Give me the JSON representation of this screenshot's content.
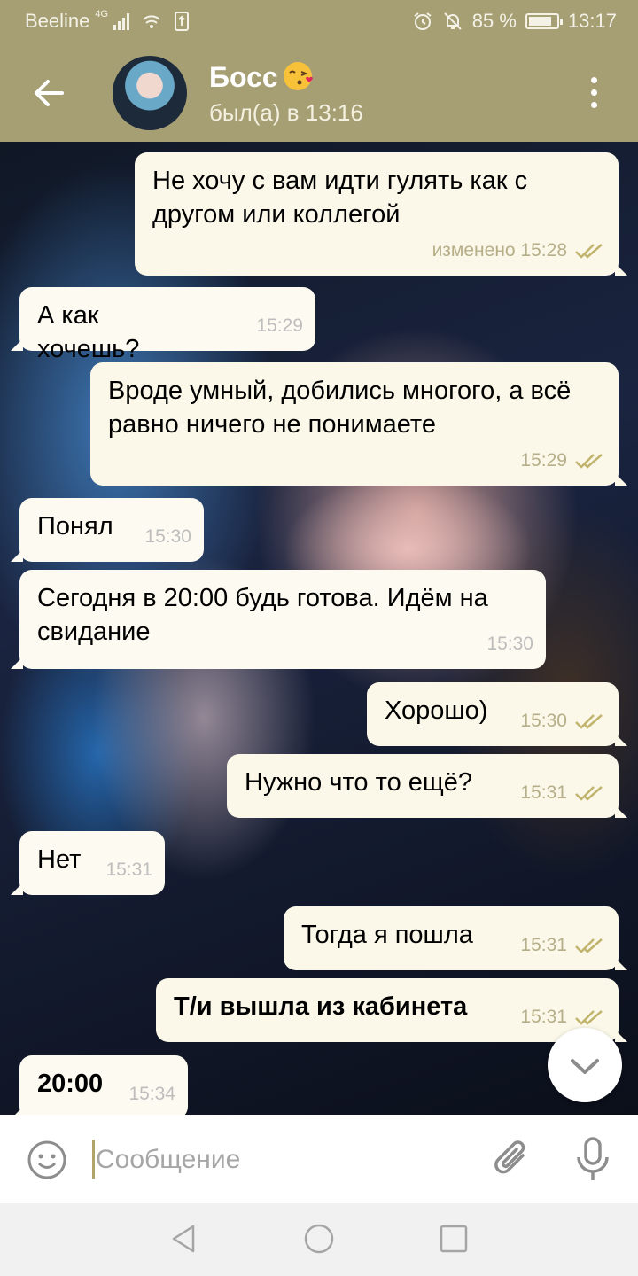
{
  "status_bar": {
    "carrier": "Beeline",
    "network": "4G",
    "battery": "85 %",
    "battery_level": 0.85,
    "time": "13:17"
  },
  "header": {
    "name": "Босс",
    "emoji_icon": "kissing-face-icon",
    "status": "был(а) в 13:16"
  },
  "messages": [
    {
      "dir": "out",
      "text": "Не хочу с вам идти гулять как с другом или коллегой",
      "time": "изменено 15:28",
      "read": true
    },
    {
      "dir": "in",
      "text": "А как хочешь?",
      "time": "15:29"
    },
    {
      "dir": "out",
      "text": "Вроде умный, добились многого, а всё равно ничего не понимаете",
      "time": "15:29",
      "read": true
    },
    {
      "dir": "in",
      "text": "Понял",
      "time": "15:30"
    },
    {
      "dir": "in",
      "text": "Сегодня в 20:00 будь готова. Идём на свидание",
      "time": "15:30"
    },
    {
      "dir": "out",
      "text": "Хорошо)",
      "time": "15:30",
      "read": true
    },
    {
      "dir": "out",
      "text": "Нужно что то ещё?",
      "time": "15:31",
      "read": true
    },
    {
      "dir": "in",
      "text": "Нет",
      "time": "15:31"
    },
    {
      "dir": "out",
      "text": "Тогда я пошла",
      "time": "15:31",
      "read": true
    },
    {
      "dir": "out",
      "text": "Т/и вышла из кабинета",
      "time": "15:31",
      "read": true,
      "bold": true
    },
    {
      "dir": "in",
      "text": "20:00",
      "time": "15:34",
      "bold": true
    }
  ],
  "composer": {
    "placeholder": "Сообщение"
  },
  "colors": {
    "header": "#a69f74",
    "accent": "#b1a46a",
    "bubble_out": "#fbf8e9",
    "bubble_in": "#fdfbf1",
    "checkmark": "#c1b46e"
  }
}
